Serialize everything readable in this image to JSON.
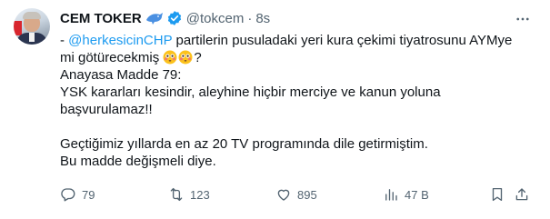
{
  "author": {
    "name": "CEM TOKER",
    "handle": "@tokcem",
    "separator": "·",
    "time": "8s"
  },
  "tweet": {
    "line1_prefix": "- ",
    "mention": "@herkesicinCHP",
    "line1_rest": " partilerin pusuladaki yeri kura çekimi tiyatrosunu AYMye",
    "line2_text": "mi götürecekmiş ",
    "line2_suffix": "?",
    "line3": "Anayasa Madde 79:",
    "line4": "YSK kararları kesindir, aleyhine hiçbir merciye ve kanun yoluna",
    "line5": "başvurulamaz!!",
    "line6": "Geçtiğimiz yıllarda en az 20 TV programında dile getirmiştim.",
    "line7": "Bu madde değişmeli diye."
  },
  "actions": {
    "replies": "79",
    "reposts": "123",
    "likes": "895",
    "views": "47 B"
  },
  "icons": [
    "dolphin-icon",
    "verified-badge-icon",
    "more-options-icon",
    "flushed-face-emoji",
    "reply-icon",
    "repost-icon",
    "like-icon",
    "views-icon",
    "bookmark-icon",
    "share-icon"
  ],
  "colors": {
    "text": "#0f1419",
    "secondary": "#536471",
    "accent": "#1d9bf0"
  }
}
